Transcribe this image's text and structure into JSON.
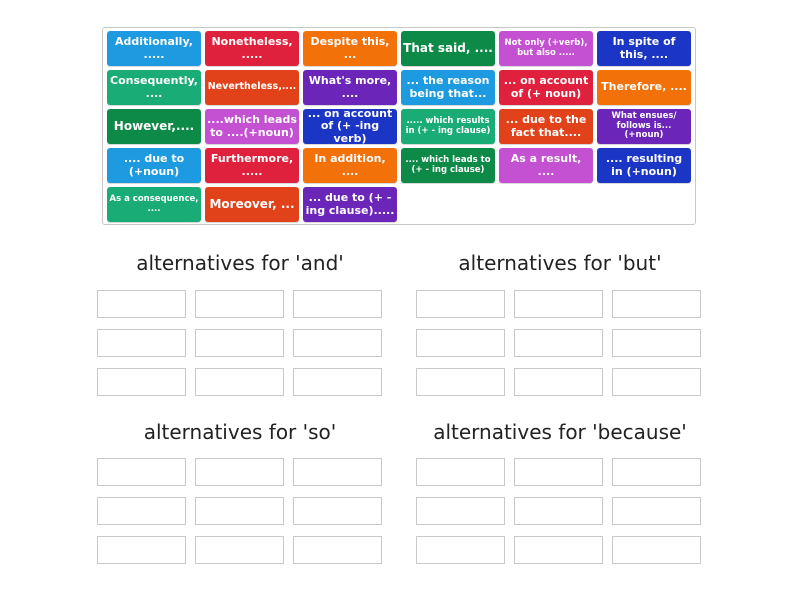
{
  "pool": {
    "tiles": [
      {
        "label": "Additionally, .....",
        "color": "#1e9be0"
      },
      {
        "label": "Nonetheless, .....",
        "color": "#e0213e"
      },
      {
        "label": "Despite this, ...",
        "color": "#f27109"
      },
      {
        "label": "That said, ....",
        "color": "#0e8a48"
      },
      {
        "label": "Not only (+verb), but also .....",
        "color": "#c450d2"
      },
      {
        "label": "In spite of this, ....",
        "color": "#1b36c4"
      },
      {
        "label": "Consequently, ....",
        "color": "#19ac77"
      },
      {
        "label": "Nevertheless,....",
        "color": "#e2421a"
      },
      {
        "label": "What's more, ....",
        "color": "#6c25b9"
      },
      {
        "label": "... the reason being that...",
        "color": "#1e9be0"
      },
      {
        "label": "... on account of (+ noun)",
        "color": "#e0213e"
      },
      {
        "label": "Therefore, ....",
        "color": "#f27109"
      },
      {
        "label": "However,....",
        "color": "#0e8a48"
      },
      {
        "label": "....which leads to ....(+noun)",
        "color": "#c450d2"
      },
      {
        "label": "... on account of (+ -ing verb)",
        "color": "#1b36c4"
      },
      {
        "label": "..... which results in (+ - ing clause)",
        "color": "#19ac77"
      },
      {
        "label": "... due to the fact that....",
        "color": "#e2421a"
      },
      {
        "label": "What ensues/ follows is... (+noun)",
        "color": "#6c25b9"
      },
      {
        "label": ".... due to (+noun)",
        "color": "#1e9be0"
      },
      {
        "label": "Furthermore, .....",
        "color": "#e0213e"
      },
      {
        "label": "In addition, ....",
        "color": "#f27109"
      },
      {
        "label": ".... which leads to (+ - ing clause)",
        "color": "#0e8a48"
      },
      {
        "label": "As a result, ....",
        "color": "#c450d2"
      },
      {
        "label": ".... resulting in (+noun)",
        "color": "#1b36c4"
      },
      {
        "label": "As a consequence, ....",
        "color": "#19ac77"
      },
      {
        "label": "Moreover, ...",
        "color": "#e2421a"
      },
      {
        "label": "... due to (+ -ing clause).....",
        "color": "#6c25b9"
      }
    ]
  },
  "groups": [
    {
      "heading": "alternatives for 'and'",
      "slots": 9
    },
    {
      "heading": "alternatives for 'but'",
      "slots": 9
    },
    {
      "heading": "alternatives for 'so'",
      "slots": 9
    },
    {
      "heading": "alternatives for 'because'",
      "slots": 9
    }
  ]
}
